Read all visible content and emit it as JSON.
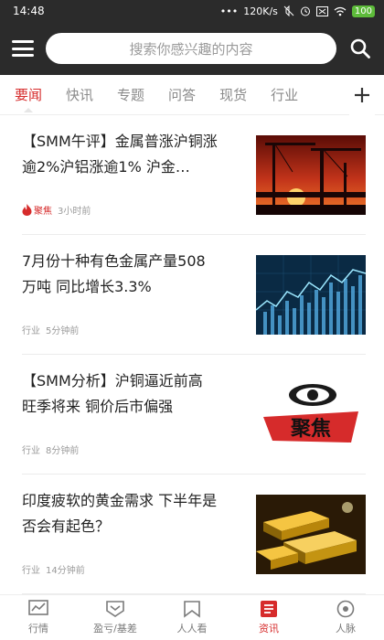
{
  "status_bar": {
    "time": "14:48",
    "network_speed": "120K/s",
    "battery": "100"
  },
  "header": {
    "search_placeholder": "搜索你感兴趣的内容"
  },
  "tabs": [
    {
      "label": "要闻",
      "active": true
    },
    {
      "label": "快讯",
      "active": false
    },
    {
      "label": "专题",
      "active": false
    },
    {
      "label": "问答",
      "active": false
    },
    {
      "label": "现货",
      "active": false
    },
    {
      "label": "行业",
      "active": false
    }
  ],
  "news": [
    {
      "title": "【SMM午评】金属普涨沪铜涨逾2%沪铝涨逾1% 沪金…",
      "tag": "聚焦",
      "time": "3小时前",
      "image": "industrial-crane-sunset-image"
    },
    {
      "title": "7月份十种有色金属产量508万吨 同比增长3.3%",
      "tag": "行业",
      "time": "5分钟前",
      "image": "stock-chart-image"
    },
    {
      "title": "【SMM分析】沪铜逼近前高 旺季将来 铜价后市偏强",
      "tag": "行业",
      "time": "8分钟前",
      "image": "focus-logo-image"
    },
    {
      "title": "印度疲软的黄金需求 下半年是否会有起色？",
      "tag": "行业",
      "time": "14分钟前",
      "image": "gold-bars-image"
    }
  ],
  "focus_logo_text": "聚焦",
  "bottom_nav": [
    {
      "label": "行情",
      "icon": "chart-icon",
      "active": false
    },
    {
      "label": "盈亏/基差",
      "icon": "profit-icon",
      "active": false
    },
    {
      "label": "人人看",
      "icon": "bookmark-icon",
      "active": false
    },
    {
      "label": "资讯",
      "icon": "news-icon",
      "active": true
    },
    {
      "label": "人脉",
      "icon": "contacts-icon",
      "active": false
    }
  ],
  "colors": {
    "accent": "#d62b2b",
    "header_bg": "#2b2b2b"
  }
}
